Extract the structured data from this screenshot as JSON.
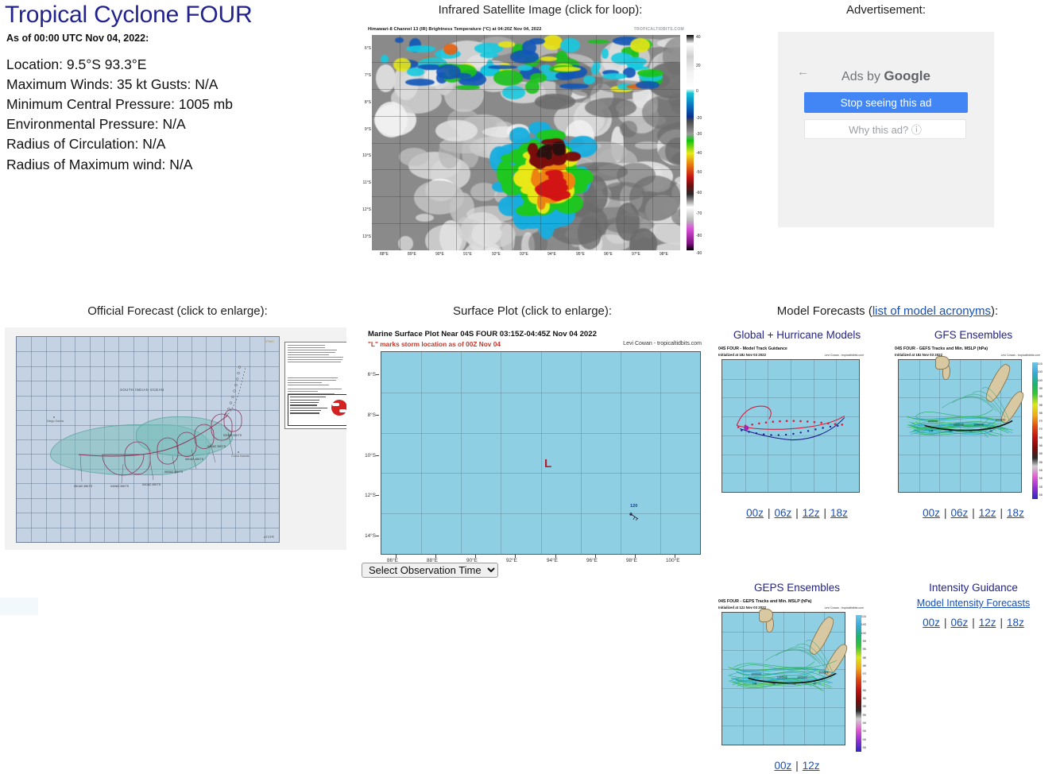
{
  "storm": {
    "title": "Tropical Cyclone FOUR",
    "as_of": "As of 00:00 UTC Nov 04, 2022:",
    "location": "Location: 9.5°S 93.3°E",
    "winds": "Maximum Winds: 35 kt  Gusts: N/A",
    "pressure": "Minimum Central Pressure: 1005 mb",
    "env_pressure": "Environmental Pressure: N/A",
    "radius_circulation": "Radius of Circulation: N/A",
    "radius_max_wind": "Radius of Maximum wind: N/A"
  },
  "satellite": {
    "heading": "Infrared Satellite Image (click for loop):",
    "image_title": "Himawari-8 Channel 13 (IR) Brightness Temperature (°C) at 04:20Z Nov 04, 2022",
    "watermark": "TROPICALTIDBITS.COM",
    "y_ticks": [
      "6°S",
      "7°S",
      "8°S",
      "9°S",
      "10°S",
      "11°S",
      "12°S",
      "13°S"
    ],
    "x_ticks": [
      "88°E",
      "89°E",
      "90°E",
      "91°E",
      "92°E",
      "93°E",
      "94°E",
      "95°E",
      "96°E",
      "97°E",
      "98°E"
    ],
    "colorbar_ticks": [
      "40",
      "20",
      "0",
      "-20",
      "-30",
      "-40",
      "-50",
      "-60",
      "-70",
      "-80",
      "-90"
    ]
  },
  "advertisement": {
    "heading": "Advertisement:",
    "back_arrow": "←",
    "ads_by_prefix": "Ads by ",
    "ads_by_brand": "Google",
    "stop_button": "Stop seeing this ad",
    "why_button": "Why this ad? ⓘ"
  },
  "official_forecast": {
    "heading": "Official Forecast (click to enlarge):",
    "ocean_label": "SOUTH INDIAN OCEAN",
    "agency_tag": "JTWC",
    "source_tag": "ATCF®",
    "island_labels": [
      "Diego Garcia",
      "Cocos Islands"
    ],
    "wind_labels": [
      "03/18Z 30KTS",
      "04/18Z 35KTS",
      "05/18Z 40KTS",
      "06/06Z 45KTS",
      "04/18Z 40KTS",
      "04/06Z 35KTS",
      "05/18Z 35KTS"
    ]
  },
  "surface_plot": {
    "heading": "Surface Plot (click to enlarge):",
    "image_title": "Marine Surface Plot Near 04S FOUR 03:15Z-04:45Z Nov 04 2022",
    "subtitle": "\"L\" marks storm location as of 00Z Nov 04",
    "credit": "Levi Cowan - tropicaltidbits.com",
    "low_marker": "L",
    "ship_value": "120",
    "y_ticks": [
      "6°S",
      "8°S",
      "10°S",
      "12°S",
      "14°S"
    ],
    "x_ticks": [
      "86°E",
      "88°E",
      "90°E",
      "92°E",
      "94°E",
      "96°E",
      "98°E",
      "100°E"
    ],
    "select_label": "Select Observation Time..."
  },
  "model_forecasts": {
    "heading_prefix": "Model Forecasts (",
    "heading_link": "list of model acronyms",
    "heading_suffix": "):",
    "panels": [
      {
        "column_title": "Global + Hurricane Models",
        "thumb_title": "04S FOUR - Model Track Guidance",
        "thumb_init": "Initialized at 18z Nov 03 2022",
        "thumb_credit": "Levi Cowan - tropicaltidbits.com",
        "times": [
          "00z",
          "06z",
          "12z",
          "18z"
        ]
      },
      {
        "column_title": "GFS Ensembles",
        "thumb_title": "04S FOUR - GEFS Tracks and Min. MSLP (hPa)",
        "thumb_init": "Initialized at 18z Nov 03 2022",
        "thumb_credit": "Levi Cowan - tropicaltidbits.com",
        "times": [
          "00z",
          "06z",
          "12z",
          "18z"
        ]
      },
      {
        "column_title": "GEPS Ensembles",
        "thumb_title": "04S FOUR - GEPS Tracks and Min. MSLP (hPa)",
        "thumb_init": "Initialized at 12z Nov 03 2022",
        "thumb_credit": "Levi Cowan - tropicaltidbits.com",
        "times": [
          "00z",
          "12z"
        ]
      }
    ],
    "intensity": {
      "column_title": "Intensity Guidance",
      "link": "Model Intensity Forecasts",
      "times": [
        "00z",
        "06z",
        "12z",
        "18z"
      ]
    },
    "mslp_colorbar_ticks": [
      "1010",
      "1005",
      "1000",
      "995",
      "990",
      "985",
      "980",
      "975",
      "970",
      "965",
      "960",
      "955",
      "950",
      "945",
      "940",
      "935",
      "930"
    ],
    "ensemble_pressure_labels": [
      "1000mb",
      "1005mb"
    ],
    "separator": "|"
  },
  "colors": {
    "title_blue": "#23238e",
    "link_blue": "#1a4fb4",
    "ad_blue": "#4285f4",
    "ocean_blue": "#8ecfe3",
    "red_low": "#b3202b"
  }
}
